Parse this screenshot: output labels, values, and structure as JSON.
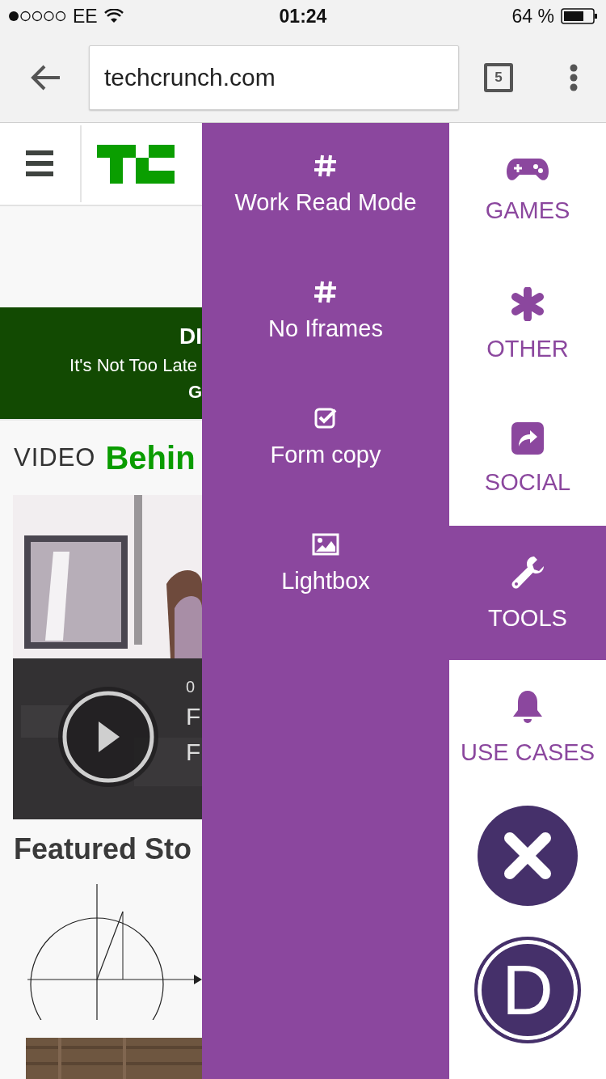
{
  "status_bar": {
    "carrier": "EE",
    "time": "01:24",
    "battery": "64 %"
  },
  "browser": {
    "url": "techcrunch.com",
    "tab_count": "5"
  },
  "page": {
    "banner": [
      "DI",
      "It's Not Too Late",
      "G"
    ],
    "video_heading": {
      "label": "VIDEO",
      "title": "Behin"
    },
    "video_overlay": [
      "0",
      "F",
      "F"
    ],
    "featured_heading": "Featured Sto"
  },
  "panel": {
    "items": [
      {
        "label": "Work Read Mode"
      },
      {
        "label": "No Iframes"
      },
      {
        "label": "Form copy"
      },
      {
        "label": "Lightbox"
      }
    ]
  },
  "categories": [
    {
      "label": "GAMES",
      "selected": false
    },
    {
      "label": "OTHER",
      "selected": false
    },
    {
      "label": "SOCIAL",
      "selected": false
    },
    {
      "label": "TOOLS",
      "selected": true
    },
    {
      "label": "USE CASES",
      "selected": false
    }
  ],
  "logo": {
    "text": "D"
  }
}
